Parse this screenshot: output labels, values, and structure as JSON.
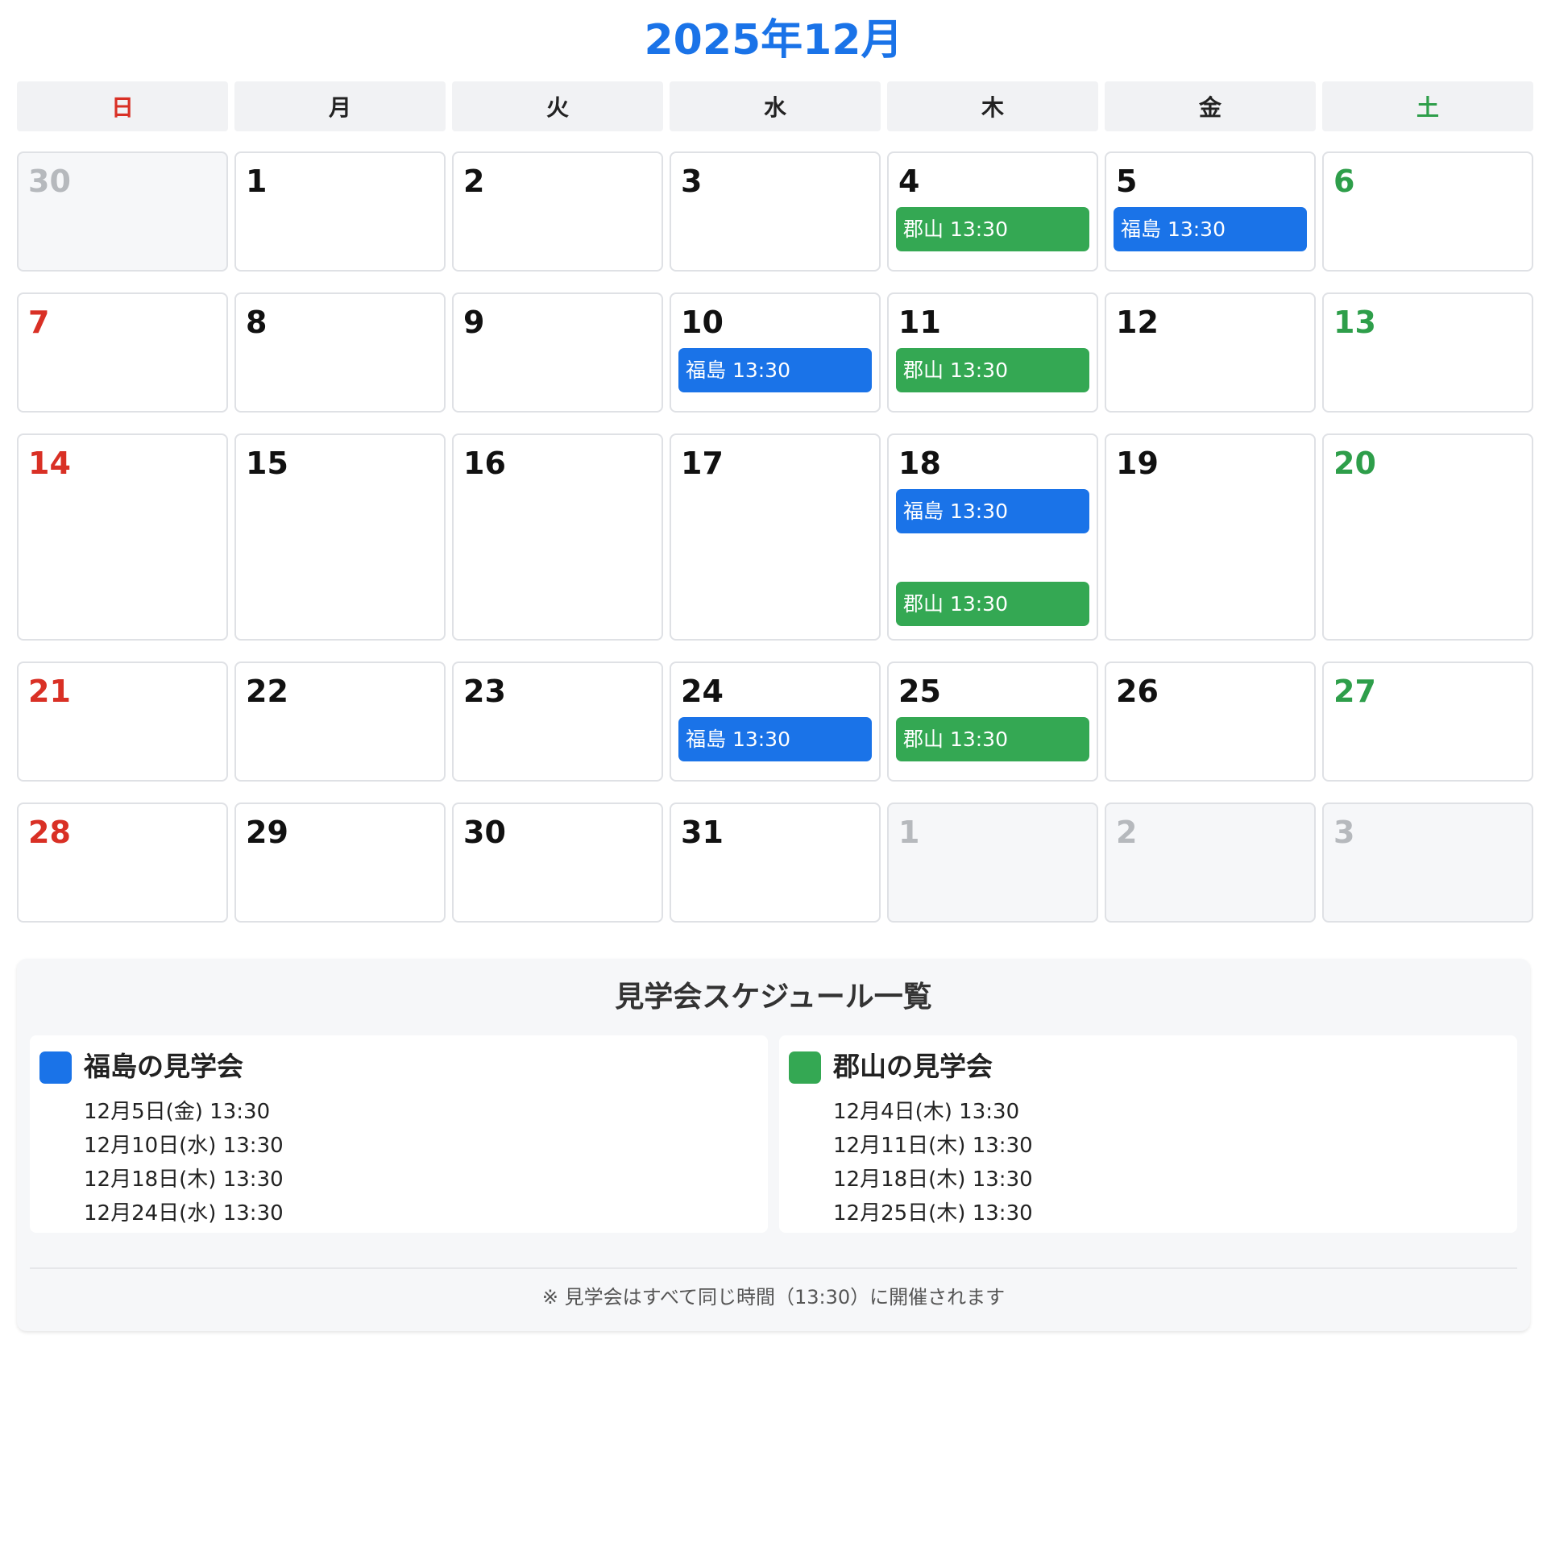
{
  "title": "2025年12月",
  "weekdays": [
    "日",
    "月",
    "火",
    "水",
    "木",
    "金",
    "土"
  ],
  "colors": {
    "accent": "#1a73e8",
    "fukushima": "#1a73e8",
    "koriyama": "#34a853",
    "sunday": "#d93025",
    "saturday": "#2e9e4a"
  },
  "weeks": [
    [
      {
        "day": "30",
        "other": true,
        "events": []
      },
      {
        "day": "1",
        "events": []
      },
      {
        "day": "2",
        "events": []
      },
      {
        "day": "3",
        "events": []
      },
      {
        "day": "4",
        "events": [
          {
            "label": "郡山 13:30",
            "color": "green"
          }
        ]
      },
      {
        "day": "5",
        "events": [
          {
            "label": "福島 13:30",
            "color": "blue"
          }
        ]
      },
      {
        "day": "6",
        "events": []
      }
    ],
    [
      {
        "day": "7",
        "events": []
      },
      {
        "day": "8",
        "events": []
      },
      {
        "day": "9",
        "events": []
      },
      {
        "day": "10",
        "events": [
          {
            "label": "福島 13:30",
            "color": "blue"
          }
        ]
      },
      {
        "day": "11",
        "events": [
          {
            "label": "郡山 13:30",
            "color": "green"
          }
        ]
      },
      {
        "day": "12",
        "events": []
      },
      {
        "day": "13",
        "events": []
      }
    ],
    [
      {
        "day": "14",
        "events": []
      },
      {
        "day": "15",
        "events": []
      },
      {
        "day": "16",
        "events": []
      },
      {
        "day": "17",
        "events": []
      },
      {
        "day": "18",
        "events": [
          {
            "label": "福島 13:30",
            "color": "blue"
          },
          {
            "label": "郡山 13:30",
            "color": "green"
          }
        ]
      },
      {
        "day": "19",
        "events": []
      },
      {
        "day": "20",
        "events": []
      }
    ],
    [
      {
        "day": "21",
        "events": []
      },
      {
        "day": "22",
        "events": []
      },
      {
        "day": "23",
        "events": []
      },
      {
        "day": "24",
        "events": [
          {
            "label": "福島 13:30",
            "color": "blue"
          }
        ]
      },
      {
        "day": "25",
        "events": [
          {
            "label": "郡山 13:30",
            "color": "green"
          }
        ]
      },
      {
        "day": "26",
        "events": []
      },
      {
        "day": "27",
        "events": []
      }
    ],
    [
      {
        "day": "28",
        "events": []
      },
      {
        "day": "29",
        "events": []
      },
      {
        "day": "30",
        "events": []
      },
      {
        "day": "31",
        "events": []
      },
      {
        "day": "1",
        "other": true,
        "events": []
      },
      {
        "day": "2",
        "other": true,
        "events": []
      },
      {
        "day": "3",
        "other": true,
        "events": []
      }
    ]
  ],
  "summary": {
    "title": "見学会スケジュール一覧",
    "locations": [
      {
        "name": "福島の見学会",
        "color": "blue",
        "dates": [
          "12月5日(金) 13:30",
          "12月10日(水) 13:30",
          "12月18日(木) 13:30",
          "12月24日(水) 13:30"
        ]
      },
      {
        "name": "郡山の見学会",
        "color": "green",
        "dates": [
          "12月4日(木) 13:30",
          "12月11日(木) 13:30",
          "12月18日(木) 13:30",
          "12月25日(木) 13:30"
        ]
      }
    ],
    "note": "※ 見学会はすべて同じ時間（13:30）に開催されます"
  }
}
